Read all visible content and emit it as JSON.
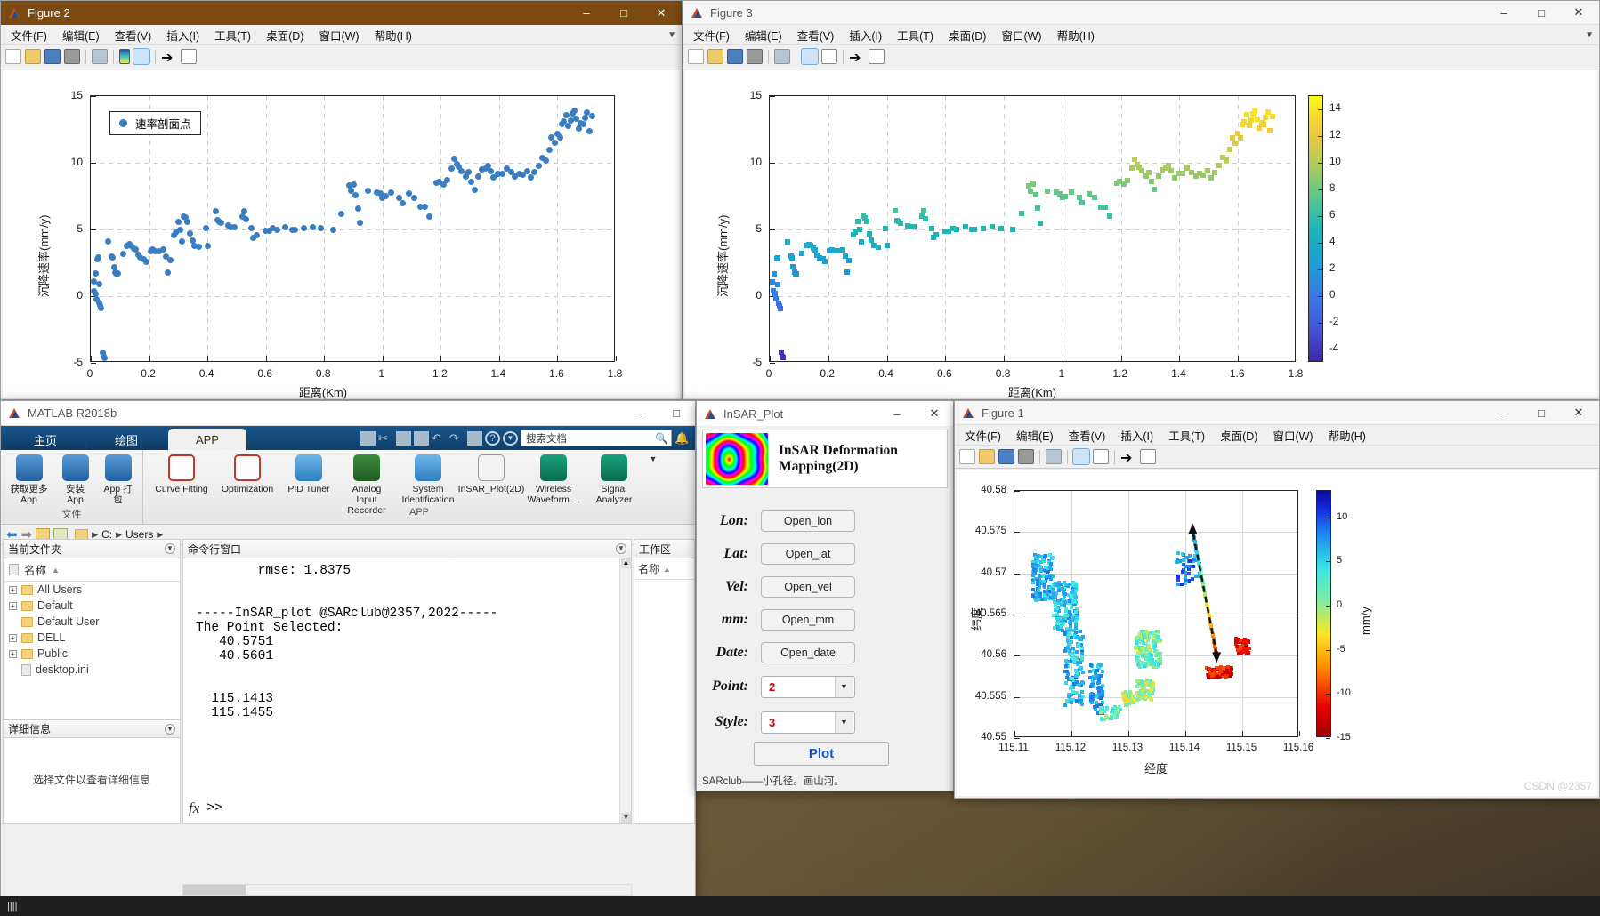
{
  "desktop": {
    "watermark": "CSDN @2357"
  },
  "figure2": {
    "title": "Figure 2",
    "icon": "matlab-logo-icon",
    "window_buttons": [
      "minimize",
      "maximize",
      "close"
    ],
    "menu": [
      "文件(F)",
      "编辑(E)",
      "查看(V)",
      "插入(I)",
      "工具(T)",
      "桌面(D)",
      "窗口(W)",
      "帮助(H)"
    ],
    "toolbar_icons": [
      "new-figure-icon",
      "open-icon",
      "save-icon",
      "print-icon",
      "print-preview-icon",
      "colorbar-icon",
      "legend-icon",
      "pointer-icon",
      "property-editor-icon"
    ],
    "chart_data": {
      "type": "scatter",
      "title": "",
      "xlabel": "距离(Km)",
      "ylabel": "沉降速率(mm/y)",
      "xlim": [
        0,
        1.8
      ],
      "ylim": [
        -5,
        15
      ],
      "xticks": [
        "0",
        "0.2",
        "0.4",
        "0.6",
        "0.8",
        "1",
        "1.2",
        "1.4",
        "1.6",
        "1.8"
      ],
      "yticks": [
        "-5",
        "0",
        "5",
        "10",
        "15"
      ],
      "grid": true,
      "legend": {
        "position": "top-left",
        "entries": [
          "速率剖面点"
        ]
      },
      "marker_color": "#3a7ec1",
      "series": [
        {
          "name": "速率剖面点",
          "points": [
            [
              0.01,
              1.1
            ],
            [
              0.012,
              0.4
            ],
            [
              0.016,
              1.7
            ],
            [
              0.018,
              0.2
            ],
            [
              0.021,
              -0.2
            ],
            [
              0.024,
              2.8
            ],
            [
              0.026,
              2.9
            ],
            [
              0.028,
              0.9
            ],
            [
              0.03,
              -0.5
            ],
            [
              0.033,
              -0.7
            ],
            [
              0.036,
              -0.9
            ],
            [
              0.04,
              -4.2
            ],
            [
              0.043,
              -4.5
            ],
            [
              0.046,
              -4.6
            ],
            [
              0.06,
              4.1
            ],
            [
              0.072,
              3.0
            ],
            [
              0.076,
              2.9
            ],
            [
              0.08,
              2.2
            ],
            [
              0.084,
              1.8
            ],
            [
              0.088,
              1.7
            ],
            [
              0.092,
              1.7
            ],
            [
              0.11,
              3.2
            ],
            [
              0.125,
              3.8
            ],
            [
              0.133,
              3.9
            ],
            [
              0.14,
              3.8
            ],
            [
              0.148,
              3.6
            ],
            [
              0.155,
              3.5
            ],
            [
              0.162,
              3.1
            ],
            [
              0.17,
              2.9
            ],
            [
              0.182,
              2.8
            ],
            [
              0.19,
              2.6
            ],
            [
              0.205,
              3.4
            ],
            [
              0.212,
              3.5
            ],
            [
              0.22,
              3.4
            ],
            [
              0.232,
              3.4
            ],
            [
              0.25,
              3.5
            ],
            [
              0.258,
              3.0
            ],
            [
              0.265,
              1.8
            ],
            [
              0.272,
              2.7
            ],
            [
              0.285,
              4.6
            ],
            [
              0.292,
              4.8
            ],
            [
              0.3,
              5.6
            ],
            [
              0.306,
              5.0
            ],
            [
              0.312,
              4.1
            ],
            [
              0.32,
              6.0
            ],
            [
              0.326,
              5.9
            ],
            [
              0.332,
              5.6
            ],
            [
              0.34,
              4.7
            ],
            [
              0.348,
              4.2
            ],
            [
              0.356,
              3.8
            ],
            [
              0.37,
              3.7
            ],
            [
              0.395,
              5.1
            ],
            [
              0.402,
              3.8
            ],
            [
              0.43,
              6.4
            ],
            [
              0.436,
              5.7
            ],
            [
              0.442,
              5.6
            ],
            [
              0.448,
              5.5
            ],
            [
              0.47,
              5.3
            ],
            [
              0.482,
              5.2
            ],
            [
              0.492,
              5.2
            ],
            [
              0.52,
              6.0
            ],
            [
              0.526,
              6.4
            ],
            [
              0.532,
              5.8
            ],
            [
              0.552,
              5.1
            ],
            [
              0.558,
              4.4
            ],
            [
              0.57,
              4.6
            ],
            [
              0.6,
              4.9
            ],
            [
              0.612,
              4.9
            ],
            [
              0.625,
              5.1
            ],
            [
              0.64,
              5.0
            ],
            [
              0.668,
              5.2
            ],
            [
              0.69,
              5.0
            ],
            [
              0.7,
              5.0
            ],
            [
              0.73,
              5.1
            ],
            [
              0.76,
              5.2
            ],
            [
              0.79,
              5.1
            ],
            [
              0.83,
              5.0
            ],
            [
              0.86,
              6.2
            ],
            [
              0.885,
              8.3
            ],
            [
              0.892,
              7.9
            ],
            [
              0.9,
              8.4
            ],
            [
              0.908,
              7.6
            ],
            [
              0.916,
              6.6
            ],
            [
              0.924,
              5.5
            ],
            [
              0.95,
              7.9
            ],
            [
              0.98,
              7.8
            ],
            [
              0.992,
              7.7
            ],
            [
              1.0,
              7.4
            ],
            [
              1.01,
              7.5
            ],
            [
              1.03,
              7.8
            ],
            [
              1.058,
              7.4
            ],
            [
              1.068,
              7.0
            ],
            [
              1.092,
              7.7
            ],
            [
              1.11,
              7.4
            ],
            [
              1.13,
              6.7
            ],
            [
              1.145,
              6.7
            ],
            [
              1.16,
              6.0
            ],
            [
              1.185,
              8.5
            ],
            [
              1.195,
              8.6
            ],
            [
              1.21,
              8.4
            ],
            [
              1.222,
              8.7
            ],
            [
              1.238,
              9.6
            ],
            [
              1.246,
              10.3
            ],
            [
              1.255,
              9.9
            ],
            [
              1.262,
              9.7
            ],
            [
              1.272,
              9.4
            ],
            [
              1.285,
              9.0
            ],
            [
              1.295,
              9.3
            ],
            [
              1.305,
              8.6
            ],
            [
              1.315,
              8.0
            ],
            [
              1.33,
              9.0
            ],
            [
              1.34,
              9.5
            ],
            [
              1.352,
              9.6
            ],
            [
              1.362,
              9.8
            ],
            [
              1.372,
              9.4
            ],
            [
              1.382,
              8.9
            ],
            [
              1.395,
              9.2
            ],
            [
              1.41,
              9.2
            ],
            [
              1.425,
              9.6
            ],
            [
              1.44,
              9.3
            ],
            [
              1.455,
              9.0
            ],
            [
              1.468,
              9.2
            ],
            [
              1.48,
              9.1
            ],
            [
              1.495,
              9.4
            ],
            [
              1.508,
              8.9
            ],
            [
              1.52,
              9.3
            ],
            [
              1.535,
              9.8
            ],
            [
              1.548,
              10.4
            ],
            [
              1.56,
              10.2
            ],
            [
              1.572,
              11.0
            ],
            [
              1.58,
              11.9
            ],
            [
              1.59,
              11.5
            ],
            [
              1.6,
              12.2
            ],
            [
              1.608,
              11.9
            ],
            [
              1.615,
              12.9
            ],
            [
              1.622,
              13.1
            ],
            [
              1.63,
              13.6
            ],
            [
              1.638,
              12.8
            ],
            [
              1.645,
              13.2
            ],
            [
              1.652,
              13.7
            ],
            [
              1.658,
              13.9
            ],
            [
              1.665,
              13.3
            ],
            [
              1.672,
              12.6
            ],
            [
              1.68,
              13.0
            ],
            [
              1.688,
              12.9
            ],
            [
              1.695,
              13.4
            ],
            [
              1.702,
              13.8
            ],
            [
              1.71,
              12.4
            ],
            [
              1.718,
              13.5
            ]
          ]
        }
      ]
    }
  },
  "figure3": {
    "title": "Figure 3",
    "icon": "matlab-logo-icon",
    "menu": [
      "文件(F)",
      "编辑(E)",
      "查看(V)",
      "插入(I)",
      "工具(T)",
      "桌面(D)",
      "窗口(W)",
      "帮助(H)"
    ],
    "toolbar_icons": [
      "new-figure-icon",
      "open-icon",
      "save-icon",
      "print-icon",
      "print-preview-icon",
      "colorbar-icon",
      "legend-icon",
      "pointer-icon",
      "property-editor-icon"
    ],
    "chart_data": {
      "type": "scatter",
      "title": "",
      "xlabel": "距离(Km)",
      "ylabel": "沉降速率(mm/y)",
      "xlim": [
        0,
        1.8
      ],
      "ylim": [
        -5,
        15
      ],
      "xticks": [
        "0",
        "0.2",
        "0.4",
        "0.6",
        "0.8",
        "1",
        "1.2",
        "1.4",
        "1.6",
        "1.8"
      ],
      "yticks": [
        "-5",
        "0",
        "5",
        "10",
        "15"
      ],
      "grid": true,
      "colormap": "parula",
      "colorbar": {
        "ticks": [
          "14",
          "12",
          "10",
          "8",
          "6",
          "4",
          "2",
          "0",
          "-2",
          "-4"
        ],
        "range": [
          -5,
          15
        ]
      },
      "note": "same points as figure2, colored by y value using parula colormap"
    }
  },
  "figure1": {
    "title": "Figure 1",
    "icon": "matlab-logo-icon",
    "menu": [
      "文件(F)",
      "编辑(E)",
      "查看(V)",
      "插入(I)",
      "工具(T)",
      "桌面(D)",
      "窗口(W)",
      "帮助(H)"
    ],
    "toolbar_icons": [
      "new-figure-icon",
      "open-icon",
      "save-icon",
      "print-icon",
      "print-preview-icon",
      "colorbar-icon",
      "legend-icon",
      "pointer-icon",
      "property-editor-icon"
    ],
    "chart_data": {
      "type": "scatter",
      "title": "",
      "xlabel": "经度",
      "ylabel": "纬度",
      "xlim": [
        115.11,
        115.16
      ],
      "ylim": [
        40.55,
        40.58
      ],
      "xticks": [
        "115.11",
        "115.12",
        "115.13",
        "115.14",
        "115.15",
        "115.16"
      ],
      "yticks": [
        "40.55",
        "40.555",
        "40.56",
        "40.565",
        "40.57",
        "40.575",
        "40.58"
      ],
      "grid": true,
      "colormap": "jet-reversed",
      "colorbar": {
        "label": "mm/y",
        "ticks": [
          "10",
          "5",
          "0",
          "-5",
          "-10",
          "-15"
        ],
        "range": [
          -15,
          13
        ]
      },
      "annotation": "dashed profile line with arrow from (115.1455,40.5601) to (115.1413,40.5751)"
    }
  },
  "matlab": {
    "title": "MATLAB R2018b",
    "icon": "matlab-logo-icon",
    "tabs": [
      {
        "label": "主页",
        "active": false
      },
      {
        "label": "绘图",
        "active": false
      },
      {
        "label": "APP",
        "active": true
      }
    ],
    "quick_access_icons": [
      "save-icon",
      "cut-icon",
      "copy-icon",
      "paste-icon",
      "undo-icon",
      "redo-icon",
      "switch-window-icon",
      "help-icon",
      "more-icon"
    ],
    "search": {
      "placeholder": "搜索文档",
      "value": "",
      "icon": "search-icon"
    },
    "notification_icon": "bell-icon",
    "ribbon": {
      "file_group": {
        "label": "文件",
        "buttons": [
          {
            "label": "获取更多 App",
            "icon": "download-app-icon"
          },
          {
            "label": "安装 App",
            "icon": "install-app-icon"
          },
          {
            "label": "App 打包",
            "icon": "package-app-icon"
          }
        ]
      },
      "app_group": {
        "label": "APP",
        "apps": [
          {
            "label": "Curve Fitting",
            "icon": "curve-fitting-icon"
          },
          {
            "label": "Optimization",
            "icon": "optimization-icon"
          },
          {
            "label": "PID Tuner",
            "icon": "pid-tuner-icon"
          },
          {
            "label": "Analog Input Recorder",
            "icon": "analog-input-icon"
          },
          {
            "label": "System Identification",
            "icon": "system-id-icon"
          },
          {
            "label": "InSAR_Plot(2D)",
            "icon": "insar-plot-icon"
          },
          {
            "label": "Wireless Waveform ...",
            "icon": "wireless-waveform-icon"
          },
          {
            "label": "Signal Analyzer",
            "icon": "signal-analyzer-icon"
          }
        ],
        "overflow_icon": "chevron-down-icon"
      }
    },
    "address_bar": {
      "back_icon": "back-arrow-icon",
      "forward_icon": "forward-arrow-icon",
      "up_icon": "up-folder-icon",
      "browse_icon": "browse-folder-icon",
      "path": [
        "C:",
        "Users"
      ]
    },
    "current_folder": {
      "header": "当前文件夹",
      "collapse_icon": "chevron-down-icon",
      "column": "名称",
      "sort_icon": "sort-ascending-icon",
      "items": [
        {
          "name": "All Users",
          "type": "folder",
          "expandable": true
        },
        {
          "name": "Default",
          "type": "folder",
          "expandable": true
        },
        {
          "name": "Default User",
          "type": "folder",
          "expandable": false
        },
        {
          "name": "DELL",
          "type": "folder",
          "expandable": true
        },
        {
          "name": "Public",
          "type": "folder",
          "expandable": true
        },
        {
          "name": "desktop.ini",
          "type": "file",
          "expandable": false
        }
      ]
    },
    "details_panel": {
      "header": "详细信息",
      "collapse_icon": "chevron-down-icon",
      "message": "选择文件以查看详细信息"
    },
    "command_window": {
      "header": "命令行窗口",
      "collapse_icon": "chevron-down-icon",
      "lines": [
        "        rmse: 1.8375",
        "",
        "",
        "-----InSAR_plot @SARclub@2357,2022-----",
        "The Point Selected:",
        "   40.5751",
        "   40.5601",
        "",
        "",
        "  115.1413",
        "  115.1455"
      ],
      "prompt_icon": "fx-icon",
      "prompt": ">>"
    },
    "workspace": {
      "header": "工作区",
      "collapse_icon": "chevron-down-icon",
      "column": "名称",
      "sort_icon": "sort-ascending-icon"
    }
  },
  "insar_dialog": {
    "title": "InSAR_Plot",
    "icon": "matlab-logo-icon",
    "window_buttons": [
      "minimize",
      "close"
    ],
    "banner": {
      "image": "interferogram-thumbnail",
      "text": "InSAR Deformation Mapping(2D)"
    },
    "fields": [
      {
        "label": "Lon:",
        "button": "Open_lon",
        "name": "open-lon-button"
      },
      {
        "label": "Lat:",
        "button": "Open_lat",
        "name": "open-lat-button"
      },
      {
        "label": "Vel:",
        "button": "Open_vel",
        "name": "open-vel-button"
      },
      {
        "label": "mm:",
        "button": "Open_mm",
        "name": "open-mm-button"
      },
      {
        "label": "Date:",
        "button": "Open_date",
        "name": "open-date-button"
      }
    ],
    "selects": [
      {
        "label": "Point:",
        "value": "2",
        "name": "point-select"
      },
      {
        "label": "Style:",
        "value": "3",
        "name": "style-select"
      }
    ],
    "plot_button": "Plot",
    "footer": "SARclub——小孔径。画山河。"
  }
}
